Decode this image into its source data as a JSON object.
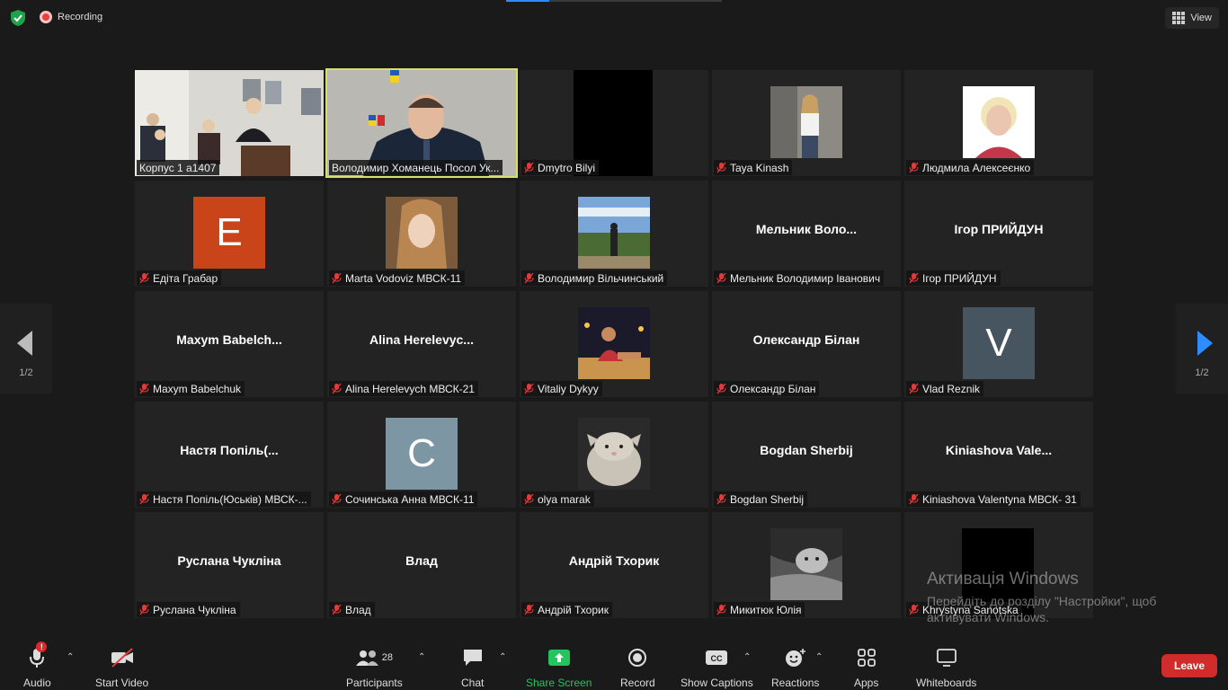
{
  "top": {
    "recording_label": "Recording",
    "view_label": "View"
  },
  "nav": {
    "page_left": "1/2",
    "page_right": "1/2"
  },
  "tiles": [
    {
      "name": "Корпус 1 а1407",
      "big": "",
      "avatar_letter": "",
      "muted": false
    },
    {
      "name": "Володимир Хоманець Посол Ук...",
      "big": "",
      "avatar_letter": "",
      "muted": false
    },
    {
      "name": "Dmytro Bilyi",
      "big": "",
      "avatar_letter": "",
      "muted": true
    },
    {
      "name": "Taya Kinash",
      "big": "",
      "avatar_letter": "",
      "muted": true
    },
    {
      "name": "Людмила Алексеєнко",
      "big": "",
      "avatar_letter": "",
      "muted": true
    },
    {
      "name": "Едіта Грабар",
      "big": "",
      "avatar_letter": "E",
      "muted": true
    },
    {
      "name": "Marta Vodoviz МВСК-11",
      "big": "",
      "avatar_letter": "",
      "muted": true
    },
    {
      "name": "Володимир Вільчинський",
      "big": "",
      "avatar_letter": "",
      "muted": true
    },
    {
      "name": "Мельник Володимир Іванович",
      "big": "Мельник  Воло...",
      "avatar_letter": "",
      "muted": true
    },
    {
      "name": "Ігор ПРИЙДУН",
      "big": "Ігор ПРИЙДУН",
      "avatar_letter": "",
      "muted": true
    },
    {
      "name": "Maxym Babelchuk",
      "big": "Maxym  Babelch...",
      "avatar_letter": "",
      "muted": true
    },
    {
      "name": "Alina Herelevych МВСК-21",
      "big": "Alina  Herelevyc...",
      "avatar_letter": "",
      "muted": true
    },
    {
      "name": "Vitaliy Dykyy",
      "big": "",
      "avatar_letter": "",
      "muted": true
    },
    {
      "name": "Олександр Білан",
      "big": "Олександр Білан",
      "avatar_letter": "",
      "muted": true
    },
    {
      "name": "Vlad Reznik",
      "big": "",
      "avatar_letter": "V",
      "muted": true
    },
    {
      "name": "Настя Попіль(Юськів) МВСК-...",
      "big": "Настя  Попіль(...",
      "avatar_letter": "",
      "muted": true
    },
    {
      "name": "Сочинська Анна МВСК-11",
      "big": "",
      "avatar_letter": "C",
      "muted": true
    },
    {
      "name": "olya marak",
      "big": "",
      "avatar_letter": "",
      "muted": true
    },
    {
      "name": "Bogdan Sherbij",
      "big": "Bogdan Sherbij",
      "avatar_letter": "",
      "muted": true
    },
    {
      "name": "Kiniashova Valentyna МВСК- 31",
      "big": "Kiniashova  Vale...",
      "avatar_letter": "",
      "muted": true
    },
    {
      "name": "Руслана Чукліна",
      "big": "Руслана Чукліна",
      "avatar_letter": "",
      "muted": true
    },
    {
      "name": "Влад",
      "big": "Влад",
      "avatar_letter": "",
      "muted": true
    },
    {
      "name": "Андрій Тхорик",
      "big": "Андрій Тхорик",
      "avatar_letter": "",
      "muted": true
    },
    {
      "name": "Микитюк Юлія",
      "big": "",
      "avatar_letter": "",
      "muted": true
    },
    {
      "name": "Khrystyna Sanotska",
      "big": "",
      "avatar_letter": "",
      "muted": true
    }
  ],
  "watermark": {
    "line1": "Активація Windows",
    "line2": "Перейдіть до розділу \"Настройки\", щоб активувати Windows."
  },
  "toolbar": {
    "audio": "Audio",
    "start_video": "Start Video",
    "participants": "Participants",
    "participants_count": "28",
    "chat": "Chat",
    "share_screen": "Share Screen",
    "record": "Record",
    "show_captions": "Show Captions",
    "reactions": "Reactions",
    "apps": "Apps",
    "whiteboards": "Whiteboards",
    "leave": "Leave",
    "audio_alert": "!",
    "cc": "CC"
  },
  "colors": {
    "accent_green": "#22c55e",
    "active_speaker": "#d6e06a",
    "leave_red": "#cf2c2b",
    "avatar_e": "#c94419",
    "avatar_v": "#46555f",
    "avatar_c": "#7d96a3"
  }
}
